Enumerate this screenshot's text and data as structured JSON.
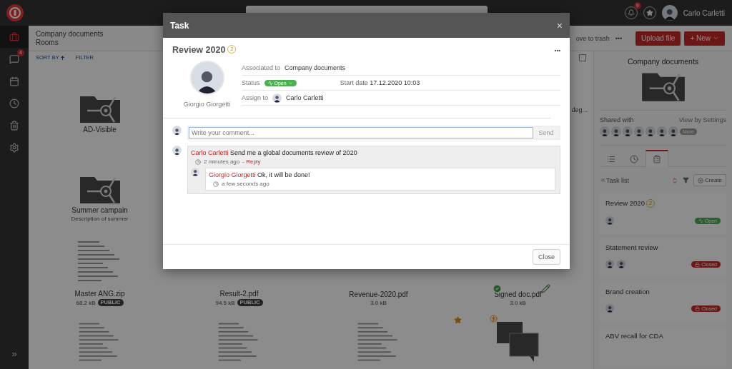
{
  "topbar": {
    "notifications": "9",
    "user": "Carlo Carletti"
  },
  "sidebar": {
    "items": [
      {
        "kind": "rooms",
        "selected": true
      },
      {
        "kind": "chat",
        "selected": false,
        "badge": "4"
      },
      {
        "kind": "calendar",
        "selected": false
      },
      {
        "kind": "clock",
        "selected": false
      },
      {
        "kind": "trash",
        "selected": false
      },
      {
        "kind": "settings",
        "selected": false
      }
    ],
    "expand": "»"
  },
  "header": {
    "title": "Company documents",
    "subtitle": "Rooms",
    "move": "ove to trash",
    "more": "•••",
    "upload": "Upload file",
    "new": "+ New"
  },
  "toolbar": {
    "sort": "SORT BY",
    "filter": "FILTER",
    "select_all": {
      "checked": false
    }
  },
  "grid": {
    "rows": [
      [
        {
          "kind": "folder",
          "name": "AD-Visible"
        },
        {
          "kind": "empty"
        },
        {
          "kind": "empty"
        },
        {
          "kind": "cut",
          "name": "deg..."
        }
      ],
      [
        {
          "kind": "folder",
          "name": "Summer campain",
          "description": "Description of summer"
        },
        {
          "kind": "empty"
        },
        {
          "kind": "empty"
        },
        {
          "kind": "empty"
        }
      ],
      [
        {
          "kind": "document",
          "name": "Master ANG.zip",
          "size": "68.2 kB",
          "badge": "PUBLIC",
          "preview": true
        },
        {
          "kind": "document",
          "name": "Result-2.pdf",
          "size": "94.5 kB",
          "badge": "PUBLIC",
          "preview": false
        },
        {
          "kind": "document",
          "name": "Revenue-2020.pdf",
          "size": "3.0 kB",
          "preview": false
        },
        {
          "kind": "document",
          "name": "Signed doc.pdf",
          "size": "3.0 kB",
          "preview": false,
          "signed": true
        }
      ],
      [
        {
          "kind": "preview"
        },
        {
          "kind": "preview"
        },
        {
          "kind": "preview"
        },
        {
          "kind": "chat",
          "starred": true
        }
      ]
    ]
  },
  "details": {
    "title": "Company documents",
    "shared_label": "Shared with",
    "settings_link": "View by Settings",
    "more": "More",
    "tabs": [
      {
        "kind": "list",
        "selected": false
      },
      {
        "kind": "history",
        "selected": false
      },
      {
        "kind": "tasks",
        "selected": true
      }
    ],
    "task_list": "Task list",
    "create": "Create",
    "tasks": [
      {
        "title": "Review 2020",
        "comments": "2",
        "assignees": [
          {
            "kind": "person"
          }
        ],
        "closed": false,
        "status_label": "Open"
      },
      {
        "title": "Statement review",
        "assignees": [
          {
            "kind": "person"
          },
          {
            "kind": "person"
          }
        ],
        "closed": true,
        "status_label": "Closed"
      },
      {
        "title": "Brand creation",
        "assignees": [
          {
            "kind": "person"
          }
        ],
        "closed": true,
        "status_label": "Closed"
      },
      {
        "title": "ABV recall for CDA"
      }
    ]
  },
  "modal": {
    "title": "Task",
    "close": "×",
    "task": {
      "title": "Review 2020",
      "comments": "2",
      "menu": "•••",
      "creator": "Giorgio Giorgetti",
      "fields": [
        {
          "kind": "text",
          "label": "Associated to",
          "value": "Company documents"
        },
        {
          "kind": "status",
          "label": "Status",
          "value": "Open",
          "closed": false,
          "extra_label": "Start date",
          "extra_value": "17.12.2020 10:03"
        },
        {
          "kind": "person",
          "label": "Assign to",
          "value": "Carlo Carletti"
        }
      ]
    },
    "comment_box": {
      "placeholder": "Write your comment...",
      "send": "Send"
    },
    "comments": [
      {
        "author": "Carlo Carletti",
        "text": "Send me a global documents review of 2020",
        "time": "2 minutes ago",
        "reply": "- Reply",
        "replies": [
          {
            "author": "Giorgio Giorgetti",
            "text": "Ok, it will be done!",
            "time": "a few seconds ago"
          }
        ]
      }
    ],
    "footer": {
      "close": "Close"
    }
  }
}
